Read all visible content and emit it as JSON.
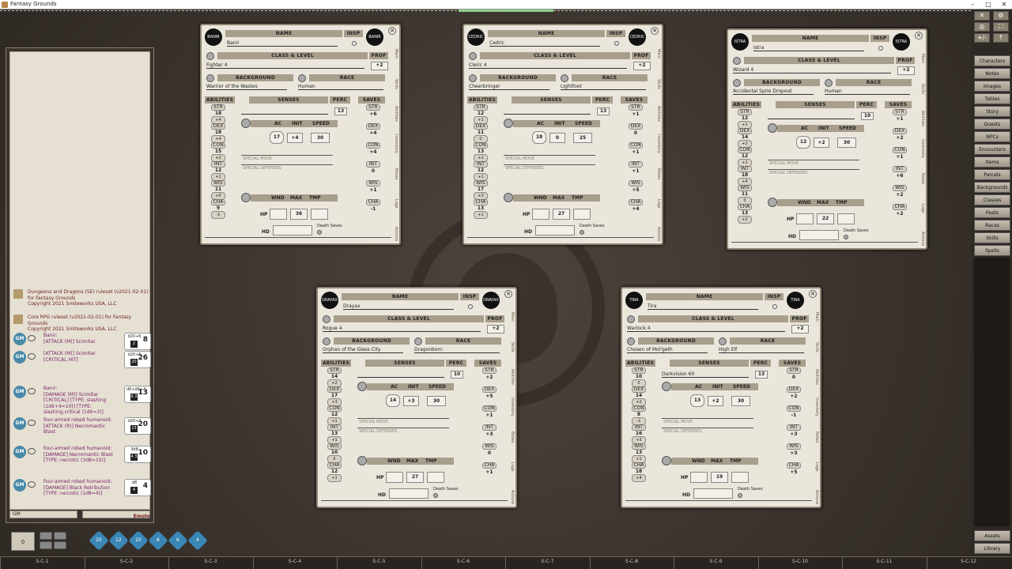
{
  "app": {
    "title": "Fantasy Grounds"
  },
  "chat": {
    "sys": [
      {
        "line1": "Dungeons and Dragons (5E) ruleset (v2021-02-01)",
        "line2": "for Fantasy Grounds",
        "line3": "Copyright 2021 Smiteworks USA, LLC"
      },
      {
        "line1": "Core RPG ruleset (v2021-02-01) for Fantasy Grounds",
        "line2": "Copyright 2021 Smiteworks USA, LLC",
        "line3": ""
      }
    ],
    "gm_label": "GM",
    "messages": [
      {
        "who": "Banir:",
        "text": "[ATTACK (M)] Scimitar",
        "dice": "d20+6",
        "die": "2",
        "total": "8"
      },
      {
        "who": "Banir:",
        "text": "[ATTACK (M)] Scimitar [CRITICAL HIT]",
        "dice": "d20+6",
        "die": "20",
        "total": "26"
      },
      {
        "who": "Banir:",
        "text": "[DAMAGE (M)] Scimitar [CRITICAL] [TYPE: slashing (1d6+4=10)] [TYPE: slashing,critical (1d6=3)]",
        "dice": "d6+d6+4",
        "die": "6 3",
        "total": "13"
      },
      {
        "who": "four-armed robed humanoid:",
        "text": "[ATTACK (R)] Necromantic Blast",
        "dice": "d20+7",
        "die": "13",
        "total": "20"
      },
      {
        "who": "four-armed robed humanoid:",
        "text": "[DAMAGE] Necromantic Blast [TYPE: necrotic (3d8=10)]",
        "dice": "3d8",
        "die": "4 3 3",
        "total": "10"
      },
      {
        "who": "four-armed robed humanoid:",
        "text": "[DAMAGE] Black Retribution [TYPE: necrotic (1d8=4)]",
        "dice": "d8",
        "die": "4",
        "total": "4"
      }
    ],
    "input_left": "GM",
    "input_right": "",
    "emote": "Emote"
  },
  "sidebar": {
    "icons": [
      "✕",
      "⚙",
      "◎",
      "⛶",
      "+/-",
      "↑"
    ],
    "buttons": [
      "Characters",
      "Notes",
      "Images",
      "Tables",
      "Story",
      "Quests",
      "NPCs",
      "Encounters",
      "Items",
      "Parcels",
      "Backgrounds",
      "Classes",
      "Feats",
      "Races",
      "Skills",
      "Spells"
    ],
    "bottom": [
      "Assets",
      "Library"
    ]
  },
  "hotbar": {
    "slots": [
      "S-C-1",
      "S-C-2",
      "S-C-3",
      "S-C-4",
      "S-C-5",
      "S-C-6",
      "S-C-7",
      "S-C-8",
      "S-C-9",
      "S-C-10",
      "S-C-11",
      "S-C-12"
    ]
  },
  "dice": {
    "tray": "0",
    "types": [
      "d20",
      "d12",
      "d10",
      "d8",
      "d6",
      "d4"
    ]
  },
  "labels": {
    "name": "NAME",
    "insp": "INSP",
    "class_level": "CLASS & LEVEL",
    "prof": "PROF",
    "background": "BACKGROUND",
    "race": "RACE",
    "abilities": "ABILITIES",
    "senses": "SENSES",
    "perc": "PERC",
    "saves": "SAVES",
    "ac": "AC",
    "init": "INIT",
    "speed": "SPEED",
    "special_move": "SPECIAL MOVE",
    "special_def": "SPECIAL DEFENSES",
    "wnd": "WND",
    "max": "MAX",
    "tmp": "TMP",
    "hp": "HP",
    "hd": "HD",
    "death": "Death Saves",
    "abil": [
      "STR",
      "DEX",
      "CON",
      "INT",
      "WIS",
      "CHA"
    ],
    "tabs": [
      "Main",
      "Skills",
      "Abilities",
      "Inventory",
      "Notes",
      "Logs",
      "Actions"
    ]
  },
  "cards": [
    {
      "portrait": "BANIR",
      "name": "Banir",
      "class": "Fighter 4",
      "prof": "+2",
      "background": "Warrior of the Wastes",
      "race": "Human",
      "senses": "",
      "perc": "13",
      "ac": "17",
      "init": "+4",
      "speed": "30",
      "hpmax": "36",
      "scores": [
        "18",
        "18",
        "15",
        "12",
        "11",
        "9"
      ],
      "mods": [
        "+4",
        "+4",
        "+2",
        "+1",
        "+0",
        "-1"
      ],
      "saves": [
        "+6",
        "+4",
        "+4",
        "0",
        "+1",
        "-1"
      ]
    },
    {
      "portrait": "CEDRIC",
      "name": "Cedric",
      "class": "Cleric 4",
      "prof": "+2",
      "background": "Cheerbringer",
      "race": "Lightfoot",
      "senses": "",
      "perc": "13",
      "ac": "18",
      "init": "0",
      "speed": "25",
      "hpmax": "27",
      "scores": [
        "12",
        "11",
        "13",
        "12",
        "17",
        "13"
      ],
      "mods": [
        "+1",
        "0",
        "+1",
        "+1",
        "+3",
        "+1"
      ],
      "saves": [
        "+1",
        "0",
        "+1",
        "+1",
        "+5",
        "+4"
      ]
    },
    {
      "portrait": "ISTRA",
      "name": "Istra",
      "class": "Wizard 4",
      "prof": "+2",
      "background": "Accidental Spire Dropout",
      "race": "Human",
      "senses": "",
      "perc": "10",
      "ac": "12",
      "init": "+2",
      "speed": "30",
      "hpmax": "22",
      "scores": [
        "12",
        "14",
        "12",
        "18",
        "11",
        "13"
      ],
      "mods": [
        "+1",
        "+2",
        "+1",
        "+4",
        "0",
        "+2"
      ],
      "saves": [
        "+1",
        "+2",
        "+1",
        "+6",
        "+2",
        "+2"
      ]
    },
    {
      "portrait": "DRAYAX",
      "name": "Drayax",
      "class": "Rogue 4",
      "prof": "+2",
      "background": "Orphan of the Glass City",
      "race": "Dragonborn",
      "senses": "",
      "perc": "10",
      "ac": "14",
      "init": "+3",
      "speed": "30",
      "hpmax": "27",
      "scores": [
        "14",
        "17",
        "12",
        "13",
        "10",
        "12"
      ],
      "mods": [
        "+2",
        "+3",
        "+1",
        "+1",
        "0",
        "+1"
      ],
      "saves": [
        "+2",
        "+5",
        "+1",
        "+3",
        "0",
        "+1"
      ]
    },
    {
      "portrait": "TIRA",
      "name": "Tira",
      "class": "Warlock 4",
      "prof": "+2",
      "background": "Chosen of Mol'geth",
      "race": "High Elf",
      "senses": "Darkvision 60",
      "perc": "13",
      "ac": "13",
      "init": "+2",
      "speed": "30",
      "hpmax": "19",
      "scores": [
        "10",
        "14",
        "8",
        "16",
        "13",
        "18"
      ],
      "mods": [
        "0",
        "+2",
        "-1",
        "+3",
        "+1",
        "+4"
      ],
      "saves": [
        "0",
        "+2",
        "-1",
        "+3",
        "+3",
        "+5"
      ]
    }
  ]
}
